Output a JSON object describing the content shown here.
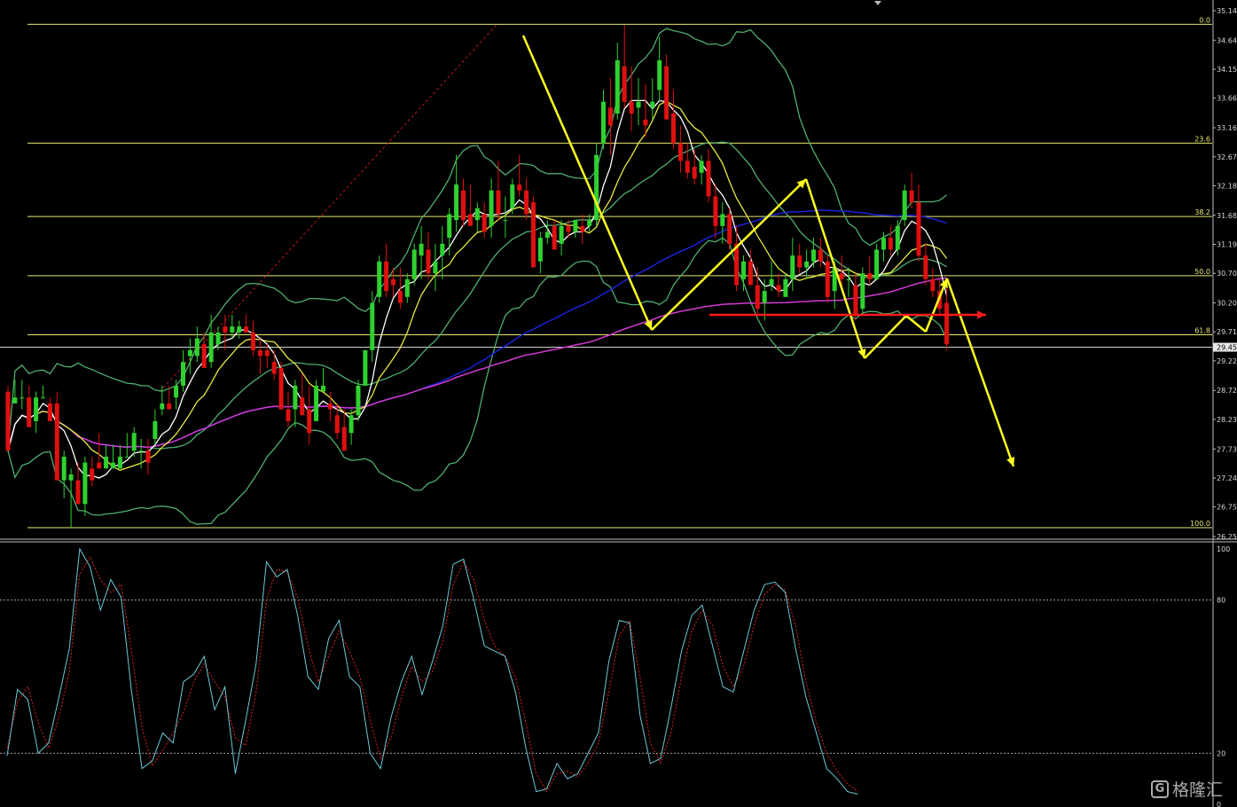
{
  "chart_data": [
    {
      "type": "candlestick",
      "title": "",
      "price_axis": {
        "ylim": [
          26.25,
          35.14
        ],
        "ticks": [
          "35.14",
          "34.64",
          "34.15",
          "33.66",
          "33.16",
          "32.67",
          "32.18",
          "31.68",
          "31.19",
          "30.70",
          "30.20",
          "29.71",
          "29.22",
          "28.72",
          "28.23",
          "27.73",
          "27.24",
          "26.75",
          "26.25"
        ],
        "tick_values": [
          35.14,
          34.64,
          34.15,
          33.66,
          33.16,
          32.67,
          32.18,
          31.68,
          31.19,
          30.7,
          30.2,
          29.71,
          29.22,
          28.72,
          28.23,
          27.73,
          27.24,
          26.75,
          26.25
        ],
        "current_price_label": "29.45",
        "current_price": 29.45
      },
      "fibonacci": {
        "levels": [
          {
            "label": "0.0",
            "price": 34.91
          },
          {
            "label": "23.6",
            "price": 32.9
          },
          {
            "label": "38.2",
            "price": 31.66
          },
          {
            "label": "50.0",
            "price": 30.66
          },
          {
            "label": "61.8",
            "price": 29.66
          },
          {
            "label": "100.0",
            "price": 26.4
          }
        ]
      },
      "colors": {
        "bull": "#2fd12f",
        "bear": "#e01010",
        "bollinger": "#4fae6e",
        "ma_fast": "#ffffff",
        "ma_mid": "#e8e840",
        "ma_slow": "#1a22d8",
        "ma_long": "#d43ad4",
        "fib": "#e8e870",
        "arrows_yellow": "#ffff20",
        "arrow_red": "#ff1a1a",
        "trendline": "#c01818"
      },
      "candles_ohlc": [
        [
          28.7,
          28.8,
          27.7,
          27.7
        ],
        [
          28.5,
          28.9,
          28.5,
          28.6
        ],
        [
          28.6,
          28.9,
          28.4,
          28.6
        ],
        [
          28.6,
          28.8,
          28.1,
          28.1
        ],
        [
          28.2,
          28.7,
          28.0,
          28.6
        ],
        [
          28.6,
          28.8,
          28.6,
          28.6
        ],
        [
          28.5,
          28.6,
          28.2,
          28.2
        ],
        [
          28.5,
          28.7,
          27.2,
          27.2
        ],
        [
          27.2,
          27.7,
          26.9,
          27.6
        ],
        [
          27.2,
          27.4,
          26.4,
          27.3
        ],
        [
          27.2,
          27.5,
          26.8,
          26.8
        ],
        [
          26.8,
          27.6,
          26.6,
          27.5
        ],
        [
          27.4,
          27.6,
          27.1,
          27.2
        ],
        [
          27.5,
          28.0,
          27.4,
          27.4
        ],
        [
          27.4,
          27.8,
          27.4,
          27.6
        ],
        [
          27.4,
          27.8,
          27.4,
          27.5
        ],
        [
          27.4,
          27.8,
          27.4,
          27.6
        ],
        [
          27.6,
          28.0,
          27.6,
          27.6
        ],
        [
          27.7,
          28.1,
          27.6,
          28.0
        ],
        [
          27.7,
          27.9,
          27.4,
          27.7
        ],
        [
          27.7,
          27.9,
          27.3,
          27.5
        ],
        [
          27.9,
          28.4,
          27.8,
          28.2
        ],
        [
          28.4,
          28.8,
          28.3,
          28.5
        ],
        [
          28.5,
          28.8,
          28.4,
          28.4
        ],
        [
          28.6,
          28.9,
          28.4,
          28.8
        ],
        [
          28.8,
          29.4,
          28.7,
          29.2
        ],
        [
          29.3,
          29.6,
          29.0,
          29.4
        ],
        [
          29.3,
          29.8,
          29.2,
          29.6
        ],
        [
          29.5,
          29.7,
          29.1,
          29.1
        ],
        [
          29.2,
          30.0,
          29.1,
          29.7
        ],
        [
          29.5,
          29.8,
          29.4,
          29.7
        ],
        [
          29.8,
          30.0,
          29.4,
          29.7
        ],
        [
          29.7,
          30.0,
          29.6,
          29.8
        ],
        [
          29.7,
          29.9,
          29.6,
          29.8
        ],
        [
          29.8,
          30.0,
          29.7,
          29.7
        ],
        [
          29.7,
          29.9,
          29.3,
          29.4
        ],
        [
          29.4,
          29.6,
          29.0,
          29.3
        ],
        [
          29.4,
          29.5,
          29.1,
          29.3
        ],
        [
          29.2,
          29.4,
          28.9,
          29.0
        ],
        [
          29.1,
          29.2,
          28.4,
          28.4
        ],
        [
          28.4,
          28.7,
          28.1,
          28.2
        ],
        [
          28.4,
          28.9,
          28.1,
          28.8
        ],
        [
          28.6,
          29.0,
          28.3,
          28.3
        ],
        [
          28.4,
          28.8,
          27.8,
          28.0
        ],
        [
          28.2,
          28.9,
          28.2,
          28.8
        ],
        [
          28.7,
          29.1,
          28.7,
          28.8
        ],
        [
          28.5,
          28.7,
          28.2,
          28.4
        ],
        [
          28.3,
          28.5,
          27.9,
          28.0
        ],
        [
          28.1,
          28.4,
          27.7,
          27.7
        ],
        [
          28.0,
          28.4,
          27.8,
          28.3
        ],
        [
          28.3,
          28.9,
          28.2,
          28.8
        ],
        [
          28.8,
          29.4,
          28.8,
          29.4
        ],
        [
          29.4,
          30.4,
          29.2,
          30.2
        ],
        [
          30.3,
          31.0,
          30.2,
          30.9
        ],
        [
          30.9,
          31.2,
          30.3,
          30.4
        ],
        [
          30.6,
          30.8,
          30.3,
          30.5
        ],
        [
          30.4,
          30.8,
          30.1,
          30.2
        ],
        [
          30.3,
          30.7,
          30.2,
          30.6
        ],
        [
          30.6,
          31.2,
          30.5,
          31.1
        ],
        [
          31.0,
          31.5,
          30.6,
          31.2
        ],
        [
          31.1,
          31.4,
          30.6,
          30.7
        ],
        [
          30.7,
          31.2,
          30.4,
          30.9
        ],
        [
          31.0,
          31.5,
          30.6,
          31.2
        ],
        [
          31.3,
          31.8,
          31.0,
          31.7
        ],
        [
          31.6,
          32.7,
          31.4,
          32.2
        ],
        [
          32.1,
          32.3,
          31.5,
          31.6
        ],
        [
          31.7,
          32.2,
          31.5,
          31.5
        ],
        [
          31.6,
          31.9,
          31.4,
          31.8
        ],
        [
          31.7,
          31.9,
          31.3,
          31.4
        ],
        [
          31.5,
          32.3,
          31.3,
          32.1
        ],
        [
          32.1,
          32.6,
          31.6,
          31.7
        ],
        [
          31.6,
          32.0,
          31.3,
          31.6
        ],
        [
          31.8,
          32.3,
          31.7,
          32.2
        ],
        [
          32.2,
          32.7,
          32.0,
          32.1
        ],
        [
          32.1,
          32.3,
          31.6,
          31.7
        ],
        [
          31.9,
          32.0,
          30.8,
          30.8
        ],
        [
          30.9,
          31.4,
          30.7,
          31.3
        ],
        [
          31.3,
          31.6,
          31.2,
          31.4
        ],
        [
          31.5,
          31.6,
          31.1,
          31.1
        ],
        [
          31.2,
          31.6,
          31.0,
          31.5
        ],
        [
          31.5,
          31.6,
          31.3,
          31.4
        ],
        [
          31.4,
          31.6,
          31.3,
          31.6
        ],
        [
          31.5,
          31.7,
          31.2,
          31.4
        ],
        [
          31.5,
          31.7,
          31.4,
          31.6
        ],
        [
          31.6,
          32.9,
          31.5,
          32.7
        ],
        [
          32.9,
          33.8,
          32.8,
          33.6
        ],
        [
          33.5,
          34.0,
          32.7,
          33.2
        ],
        [
          33.4,
          34.6,
          33.3,
          34.3
        ],
        [
          34.2,
          34.9,
          33.5,
          33.6
        ],
        [
          33.6,
          34.2,
          33.1,
          33.4
        ],
        [
          33.5,
          34.0,
          33.2,
          33.6
        ],
        [
          33.3,
          33.9,
          33.0,
          33.2
        ],
        [
          33.5,
          34.0,
          33.3,
          33.6
        ],
        [
          33.8,
          34.7,
          33.6,
          34.3
        ],
        [
          34.2,
          34.4,
          33.3,
          33.3
        ],
        [
          33.4,
          33.8,
          32.8,
          32.9
        ],
        [
          32.9,
          33.2,
          32.4,
          32.6
        ],
        [
          32.6,
          32.9,
          32.3,
          32.4
        ],
        [
          32.5,
          32.8,
          32.2,
          32.3
        ],
        [
          32.4,
          32.7,
          32.2,
          32.6
        ],
        [
          32.6,
          32.8,
          31.9,
          32.0
        ],
        [
          32.0,
          32.2,
          31.3,
          31.5
        ],
        [
          31.5,
          31.9,
          31.2,
          31.7
        ],
        [
          31.7,
          31.8,
          31.1,
          31.2
        ],
        [
          31.2,
          31.5,
          30.4,
          30.5
        ],
        [
          30.6,
          31.0,
          30.4,
          30.9
        ],
        [
          30.9,
          31.1,
          30.5,
          30.5
        ],
        [
          30.5,
          30.8,
          30.0,
          30.1
        ],
        [
          30.2,
          30.6,
          29.9,
          30.4
        ],
        [
          30.5,
          30.9,
          30.4,
          30.6
        ],
        [
          30.5,
          30.7,
          30.3,
          30.4
        ],
        [
          30.3,
          30.7,
          30.3,
          30.6
        ],
        [
          30.6,
          31.3,
          30.4,
          31.0
        ],
        [
          31.0,
          31.2,
          30.7,
          30.8
        ],
        [
          30.8,
          31.1,
          30.6,
          30.9
        ],
        [
          30.9,
          31.3,
          30.8,
          31.1
        ],
        [
          31.1,
          31.3,
          30.8,
          30.9
        ],
        [
          30.9,
          31.0,
          30.2,
          30.3
        ],
        [
          30.4,
          30.9,
          30.1,
          30.8
        ],
        [
          30.7,
          31.0,
          30.5,
          30.6
        ],
        [
          30.6,
          30.8,
          30.3,
          30.6
        ],
        [
          30.5,
          30.7,
          29.9,
          30.0
        ],
        [
          30.1,
          30.8,
          30.0,
          30.7
        ],
        [
          30.7,
          31.0,
          30.5,
          30.6
        ],
        [
          30.6,
          31.2,
          30.6,
          31.1
        ],
        [
          31.1,
          31.4,
          30.9,
          31.3
        ],
        [
          31.3,
          31.5,
          31.0,
          31.1
        ],
        [
          31.1,
          31.6,
          31.0,
          31.5
        ],
        [
          31.6,
          32.2,
          31.5,
          32.1
        ],
        [
          32.1,
          32.4,
          31.8,
          31.9
        ],
        [
          31.9,
          32.2,
          30.9,
          31.0
        ],
        [
          31.0,
          31.2,
          30.5,
          30.6
        ],
        [
          30.6,
          30.8,
          30.3,
          30.4
        ],
        [
          30.4,
          30.6,
          30.0,
          30.1
        ],
        [
          30.2,
          30.5,
          29.4,
          29.5
        ]
      ],
      "stochastic": {
        "ylim": [
          0,
          100
        ],
        "ticks": [
          "100",
          "80",
          "20",
          "0"
        ],
        "tick_values": [
          100,
          80,
          20,
          0
        ],
        "levels": [
          80,
          20
        ],
        "k_color": "#6cc8d8",
        "d_color": "#e02020",
        "k": [
          19,
          45,
          41,
          20,
          24,
          42,
          61,
          100,
          93,
          76,
          88,
          81,
          44,
          14,
          17,
          28,
          24,
          48,
          51,
          58,
          37,
          46,
          12,
          33,
          55,
          95,
          89,
          92,
          74,
          50,
          45,
          65,
          72,
          50,
          46,
          20,
          14,
          34,
          48,
          58,
          43,
          56,
          70,
          94,
          96,
          80,
          62,
          60,
          58,
          44,
          22,
          5,
          6,
          16,
          10,
          12,
          20,
          28,
          56,
          72,
          71,
          35,
          16,
          18,
          38,
          60,
          74,
          78,
          62,
          46,
          44,
          60,
          76,
          86,
          87,
          83,
          61,
          42,
          28,
          14,
          10,
          5,
          4
        ],
        "d": [
          22,
          40,
          46,
          32,
          22,
          34,
          52,
          90,
          97,
          88,
          83,
          86,
          60,
          30,
          15,
          21,
          28,
          36,
          48,
          55,
          48,
          42,
          26,
          23,
          44,
          80,
          92,
          91,
          81,
          62,
          48,
          58,
          68,
          60,
          50,
          33,
          18,
          26,
          42,
          54,
          48,
          52,
          64,
          86,
          95,
          88,
          72,
          62,
          58,
          50,
          32,
          12,
          5,
          12,
          13,
          11,
          16,
          24,
          44,
          66,
          72,
          50,
          24,
          16,
          28,
          50,
          68,
          76,
          70,
          54,
          46,
          54,
          70,
          82,
          86,
          84,
          70,
          48,
          32,
          20,
          13,
          8,
          5
        ]
      },
      "annotations_text": []
    }
  ],
  "watermark": {
    "icon_glyph": "G",
    "text": "格隆汇"
  }
}
